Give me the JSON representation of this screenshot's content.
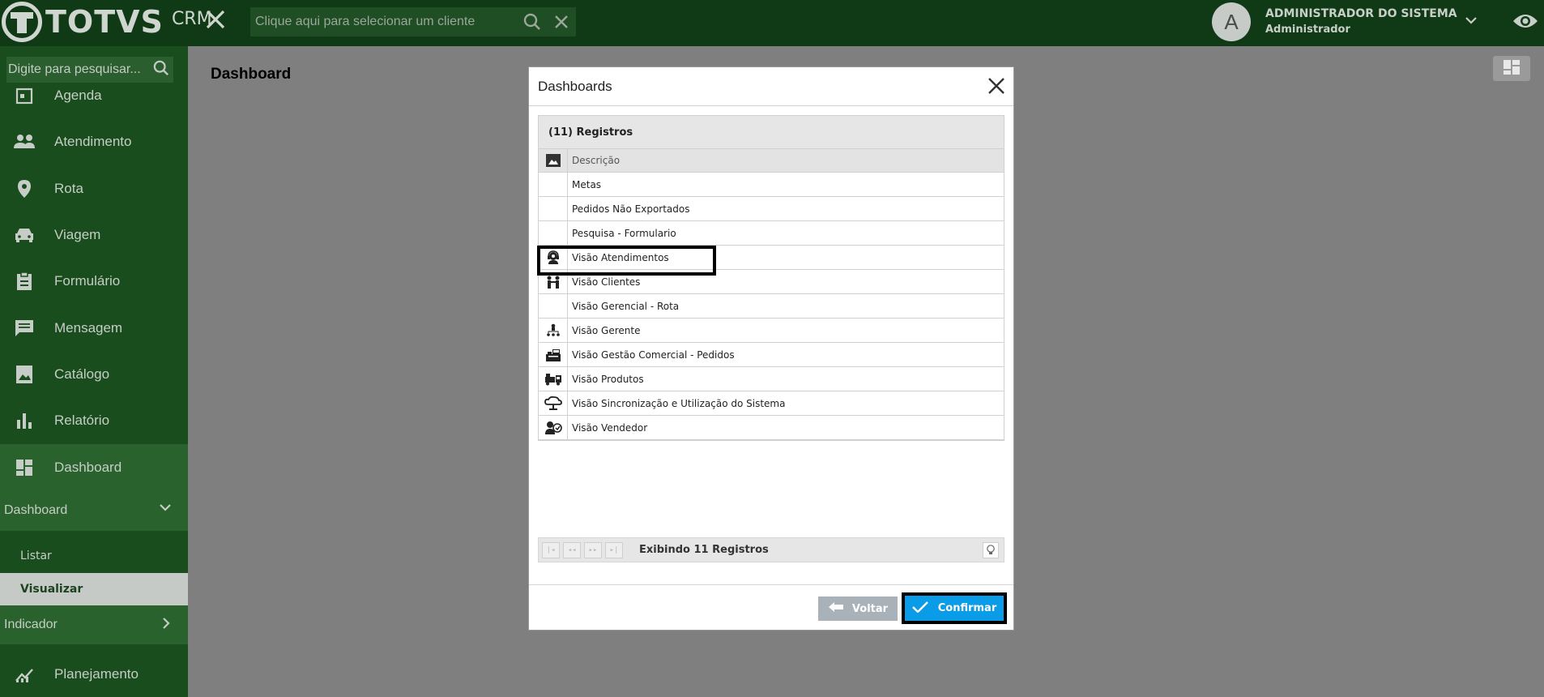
{
  "topbar": {
    "brand": "TOTVS",
    "product": "CRM",
    "client_placeholder": "Clique aqui para selecionar um cliente",
    "user_initial": "A",
    "user_name": "ADMINISTRADOR DO SISTEMA",
    "user_role": "Administrador"
  },
  "sidebar": {
    "search_placeholder": "Digite para pesquisar...",
    "items": [
      {
        "label": "Agenda",
        "icon": "calendar-icon"
      },
      {
        "label": "Atendimento",
        "icon": "people-icon"
      },
      {
        "label": "Rota",
        "icon": "location-pin-icon"
      },
      {
        "label": "Viagem",
        "icon": "car-icon"
      },
      {
        "label": "Formulário",
        "icon": "clipboard-icon"
      },
      {
        "label": "Mensagem",
        "icon": "message-icon"
      },
      {
        "label": "Catálogo",
        "icon": "image-icon"
      },
      {
        "label": "Relatório",
        "icon": "bar-chart-icon"
      },
      {
        "label": "Dashboard",
        "icon": "dashboard-icon"
      }
    ],
    "submenu_title": "Dashboard",
    "submenu": [
      {
        "label": "Listar"
      },
      {
        "label": "Visualizar"
      }
    ],
    "indicador": "Indicador",
    "planejamento": "Planejamento"
  },
  "main": {
    "title": "Dashboard"
  },
  "modal": {
    "title": "Dashboards",
    "caption": "(11) Registros",
    "column_header": "Descrição",
    "rows": [
      {
        "label": "Metas",
        "icon": ""
      },
      {
        "label": "Pedidos Não Exportados",
        "icon": ""
      },
      {
        "label": "Pesquisa - Formulario",
        "icon": ""
      },
      {
        "label": "Visão Atendimentos",
        "icon": "headset-agent-icon"
      },
      {
        "label": "Visão Clientes",
        "icon": "clients-icon"
      },
      {
        "label": "Visão Gerencial - Rota",
        "icon": ""
      },
      {
        "label": "Visão Gerente",
        "icon": "org-chart-icon"
      },
      {
        "label": "Visão Gestão Comercial - Pedidos",
        "icon": "cash-register-icon"
      },
      {
        "label": "Visão Produtos",
        "icon": "truck-boxes-icon"
      },
      {
        "label": "Visão Sincronização e Utilização do Sistema",
        "icon": "cloud-sync-icon"
      },
      {
        "label": "Visão Vendedor",
        "icon": "salesperson-icon"
      }
    ],
    "pager_text": "Exibindo 11 Registros",
    "back_label": "Voltar",
    "confirm_label": "Confirmar"
  },
  "colors": {
    "topbar": "#0f3a15",
    "sidebar": "#194d1d",
    "sidebar_active": "#2a622e",
    "confirm": "#0a9ce6",
    "back": "#a9b2b9"
  }
}
